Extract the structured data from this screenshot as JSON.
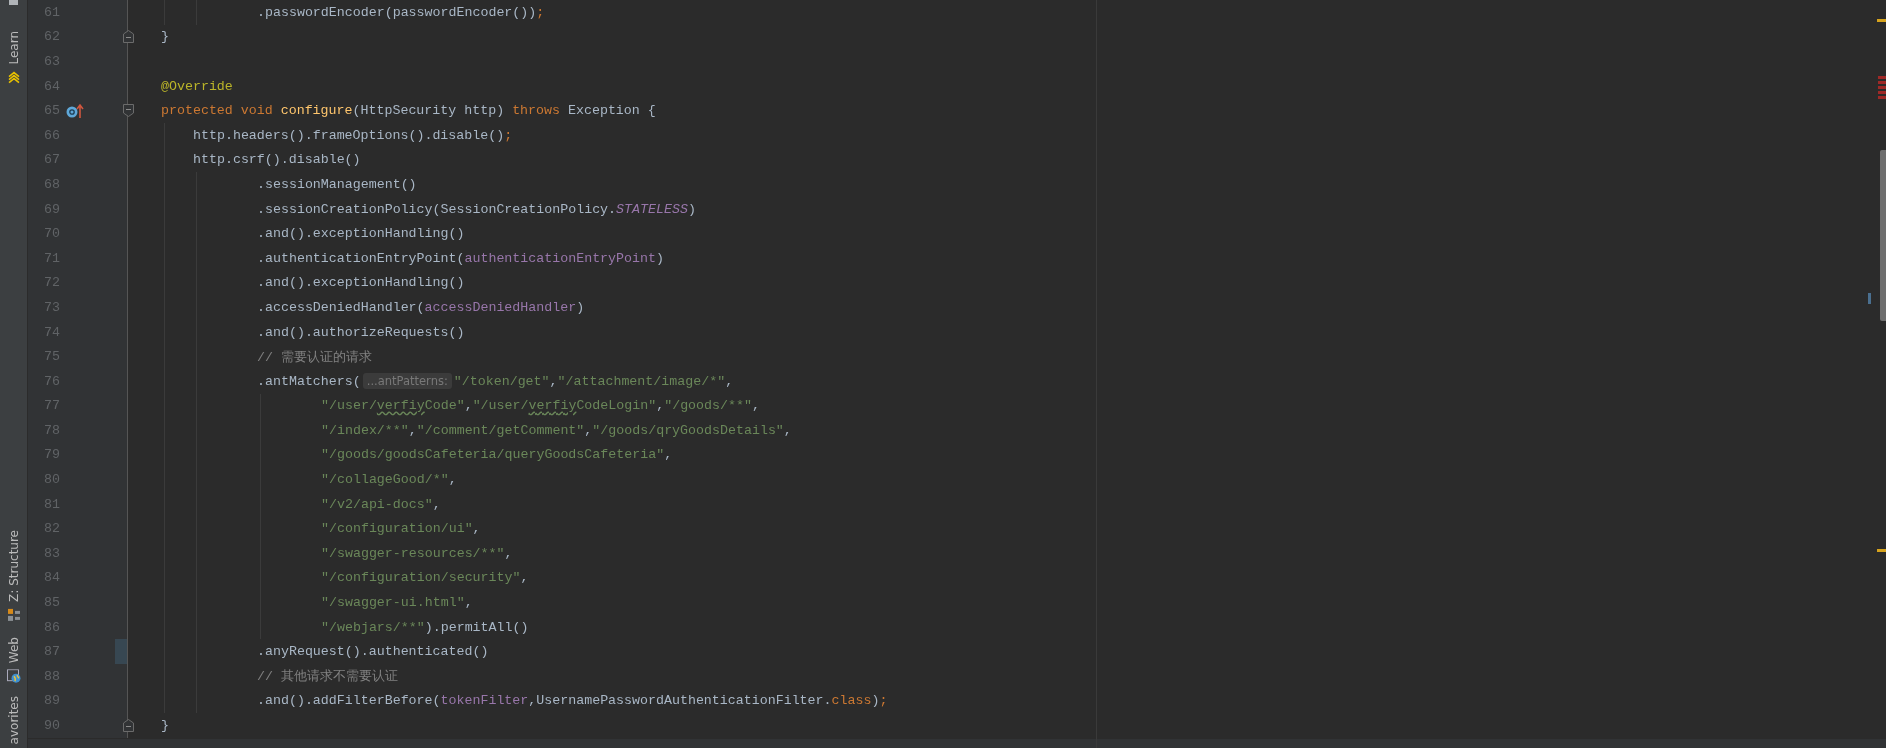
{
  "tool_strip": [
    {
      "kind": "learn",
      "label": "Learn"
    },
    {
      "kind": "structure",
      "label": "Z: Structure"
    },
    {
      "kind": "web",
      "label": "Web"
    },
    {
      "kind": "favorites",
      "label": "avorites"
    }
  ],
  "lines": [
    {
      "number": "61",
      "kind": "chain",
      "fold_start": false,
      "fold_end": false,
      "changed": false,
      "overrides": false,
      "tokens": [
        {
          "kind": "plain",
          "text": ".passwordEncoder(passwordEncoder())"
        },
        {
          "kind": "keyword",
          "text": ";"
        }
      ]
    },
    {
      "number": "62",
      "kind": "top",
      "fold_start": false,
      "fold_end": true,
      "changed": false,
      "overrides": false,
      "tokens": [
        {
          "kind": "plain",
          "text": "}"
        }
      ]
    },
    {
      "number": "63",
      "kind": "top",
      "fold_start": false,
      "fold_end": false,
      "changed": false,
      "overrides": false
    },
    {
      "number": "64",
      "kind": "top",
      "fold_start": false,
      "fold_end": false,
      "changed": false,
      "overrides": false,
      "tokens": [
        {
          "kind": "annotation",
          "text": "@Override"
        }
      ]
    },
    {
      "number": "65",
      "kind": "top",
      "fold_start": true,
      "fold_end": false,
      "changed": false,
      "overrides": true,
      "tokens": [
        {
          "kind": "keyword",
          "text": "protected void "
        },
        {
          "kind": "method",
          "text": "configure"
        },
        {
          "kind": "plain",
          "text": "(HttpSecurity http) "
        },
        {
          "kind": "keyword",
          "text": "throws"
        },
        {
          "kind": "plain",
          "text": " Exception {"
        }
      ]
    },
    {
      "number": "66",
      "kind": "body",
      "fold_start": false,
      "fold_end": false,
      "changed": false,
      "overrides": false,
      "tokens": [
        {
          "kind": "plain",
          "text": "http.headers().frameOptions().disable()"
        },
        {
          "kind": "keyword",
          "text": ";"
        }
      ]
    },
    {
      "number": "67",
      "kind": "body",
      "fold_start": false,
      "fold_end": false,
      "changed": false,
      "overrides": false,
      "tokens": [
        {
          "kind": "plain",
          "text": "http.csrf().disable()"
        }
      ]
    },
    {
      "number": "68",
      "kind": "chain",
      "fold_start": false,
      "fold_end": false,
      "changed": false,
      "overrides": false,
      "tokens": [
        {
          "kind": "plain",
          "text": ".sessionManagement()"
        }
      ]
    },
    {
      "number": "69",
      "kind": "chain",
      "fold_start": false,
      "fold_end": false,
      "changed": false,
      "overrides": false,
      "tokens": [
        {
          "kind": "plain",
          "text": ".sessionCreationPolicy(SessionCreationPolicy."
        },
        {
          "kind": "constant",
          "text": "STATELESS"
        },
        {
          "kind": "plain",
          "text": ")"
        }
      ]
    },
    {
      "number": "70",
      "kind": "chain",
      "fold_start": false,
      "fold_end": false,
      "changed": false,
      "overrides": false,
      "tokens": [
        {
          "kind": "plain",
          "text": ".and().exceptionHandling()"
        }
      ]
    },
    {
      "number": "71",
      "kind": "chain",
      "fold_start": false,
      "fold_end": false,
      "changed": false,
      "overrides": false,
      "tokens": [
        {
          "kind": "plain",
          "text": ".authenticationEntryPoint("
        },
        {
          "kind": "field",
          "text": "authenticationEntryPoint"
        },
        {
          "kind": "plain",
          "text": ")"
        }
      ]
    },
    {
      "number": "72",
      "kind": "chain",
      "fold_start": false,
      "fold_end": false,
      "changed": false,
      "overrides": false,
      "tokens": [
        {
          "kind": "plain",
          "text": ".and().exceptionHandling()"
        }
      ]
    },
    {
      "number": "73",
      "kind": "chain",
      "fold_start": false,
      "fold_end": false,
      "changed": false,
      "overrides": false,
      "tokens": [
        {
          "kind": "plain",
          "text": ".accessDeniedHandler("
        },
        {
          "kind": "field",
          "text": "accessDeniedHandler"
        },
        {
          "kind": "plain",
          "text": ")"
        }
      ]
    },
    {
      "number": "74",
      "kind": "chain",
      "fold_start": false,
      "fold_end": false,
      "changed": false,
      "overrides": false,
      "tokens": [
        {
          "kind": "plain",
          "text": ".and().authorizeRequests()"
        }
      ]
    },
    {
      "number": "75",
      "kind": "chain",
      "fold_start": false,
      "fold_end": false,
      "changed": false,
      "overrides": false,
      "tokens": [
        {
          "kind": "comment",
          "text": "// 需要认证的请求"
        }
      ]
    },
    {
      "number": "76",
      "kind": "chain",
      "fold_start": false,
      "fold_end": false,
      "changed": false,
      "overrides": false,
      "tokens": [
        {
          "kind": "plain",
          "text": ".antMatchers("
        },
        {
          "kind": "hint",
          "text": "...antPatterns:"
        },
        {
          "kind": "string",
          "text": "\"/token/get\""
        },
        {
          "kind": "plain",
          "text": ","
        },
        {
          "kind": "string",
          "text": "\"/attachment/image/*\""
        },
        {
          "kind": "plain",
          "text": ","
        }
      ]
    },
    {
      "number": "77",
      "kind": "args",
      "fold_start": false,
      "fold_end": false,
      "changed": false,
      "overrides": false,
      "tokens": [
        {
          "kind": "string",
          "text": "\"/user/"
        },
        {
          "kind": "typo",
          "text": "verfiy"
        },
        {
          "kind": "string",
          "text": "Code\""
        },
        {
          "kind": "plain",
          "text": ","
        },
        {
          "kind": "string",
          "text": "\"/user/"
        },
        {
          "kind": "typo",
          "text": "verfiy"
        },
        {
          "kind": "string",
          "text": "CodeLogin\""
        },
        {
          "kind": "plain",
          "text": ","
        },
        {
          "kind": "string",
          "text": "\"/goods/**\""
        },
        {
          "kind": "plain",
          "text": ","
        }
      ]
    },
    {
      "number": "78",
      "kind": "args",
      "fold_start": false,
      "fold_end": false,
      "changed": false,
      "overrides": false,
      "tokens": [
        {
          "kind": "string",
          "text": "\"/index/**\""
        },
        {
          "kind": "plain",
          "text": ","
        },
        {
          "kind": "string",
          "text": "\"/comment/getComment\""
        },
        {
          "kind": "plain",
          "text": ","
        },
        {
          "kind": "string",
          "text": "\"/goods/qryGoodsDetails\""
        },
        {
          "kind": "plain",
          "text": ","
        }
      ]
    },
    {
      "number": "79",
      "kind": "args",
      "fold_start": false,
      "fold_end": false,
      "changed": false,
      "overrides": false,
      "tokens": [
        {
          "kind": "string",
          "text": "\"/goods/goodsCafeteria/queryGoodsCafeteria\""
        },
        {
          "kind": "plain",
          "text": ","
        }
      ]
    },
    {
      "number": "80",
      "kind": "args",
      "fold_start": false,
      "fold_end": false,
      "changed": false,
      "overrides": false,
      "tokens": [
        {
          "kind": "string",
          "text": "\"/collageGood/*\""
        },
        {
          "kind": "plain",
          "text": ","
        }
      ]
    },
    {
      "number": "81",
      "kind": "args",
      "fold_start": false,
      "fold_end": false,
      "changed": false,
      "overrides": false,
      "tokens": [
        {
          "kind": "string",
          "text": "\"/v2/api-docs\""
        },
        {
          "kind": "plain",
          "text": ","
        }
      ]
    },
    {
      "number": "82",
      "kind": "args",
      "fold_start": false,
      "fold_end": false,
      "changed": false,
      "overrides": false,
      "tokens": [
        {
          "kind": "string",
          "text": "\"/configuration/ui\""
        },
        {
          "kind": "plain",
          "text": ","
        }
      ]
    },
    {
      "number": "83",
      "kind": "args",
      "fold_start": false,
      "fold_end": false,
      "changed": false,
      "overrides": false,
      "tokens": [
        {
          "kind": "string",
          "text": "\"/swagger-resources/**\""
        },
        {
          "kind": "plain",
          "text": ","
        }
      ]
    },
    {
      "number": "84",
      "kind": "args",
      "fold_start": false,
      "fold_end": false,
      "changed": false,
      "overrides": false,
      "tokens": [
        {
          "kind": "string",
          "text": "\"/configuration/security\""
        },
        {
          "kind": "plain",
          "text": ","
        }
      ]
    },
    {
      "number": "85",
      "kind": "args",
      "fold_start": false,
      "fold_end": false,
      "changed": false,
      "overrides": false,
      "tokens": [
        {
          "kind": "string",
          "text": "\"/swagger-ui.html\""
        },
        {
          "kind": "plain",
          "text": ","
        }
      ]
    },
    {
      "number": "86",
      "kind": "args",
      "fold_start": false,
      "fold_end": false,
      "changed": false,
      "overrides": false,
      "tokens": [
        {
          "kind": "string",
          "text": "\"/webjars/**\""
        },
        {
          "kind": "plain",
          "text": ").permitAll()"
        }
      ]
    },
    {
      "number": "87",
      "kind": "chain",
      "fold_start": false,
      "fold_end": false,
      "changed": true,
      "overrides": false,
      "tokens": [
        {
          "kind": "plain",
          "text": ".anyRequest().authenticated()"
        }
      ]
    },
    {
      "number": "88",
      "kind": "chain",
      "fold_start": false,
      "fold_end": false,
      "changed": false,
      "overrides": false,
      "tokens": [
        {
          "kind": "comment",
          "text": "// 其他请求不需要认证"
        }
      ]
    },
    {
      "number": "89",
      "kind": "chain",
      "fold_start": false,
      "fold_end": false,
      "changed": false,
      "overrides": false,
      "tokens": [
        {
          "kind": "plain",
          "text": ".and().addFilterBefore("
        },
        {
          "kind": "field",
          "text": "tokenFilter"
        },
        {
          "kind": "plain",
          "text": ",UsernamePasswordAuthenticationFilter."
        },
        {
          "kind": "keyword",
          "text": "class"
        },
        {
          "kind": "plain",
          "text": ")"
        },
        {
          "kind": "keyword",
          "text": ";"
        }
      ]
    },
    {
      "number": "90",
      "kind": "top",
      "fold_start": false,
      "fold_end": true,
      "changed": false,
      "overrides": false,
      "tokens": [
        {
          "kind": "plain",
          "text": "}"
        }
      ]
    }
  ]
}
